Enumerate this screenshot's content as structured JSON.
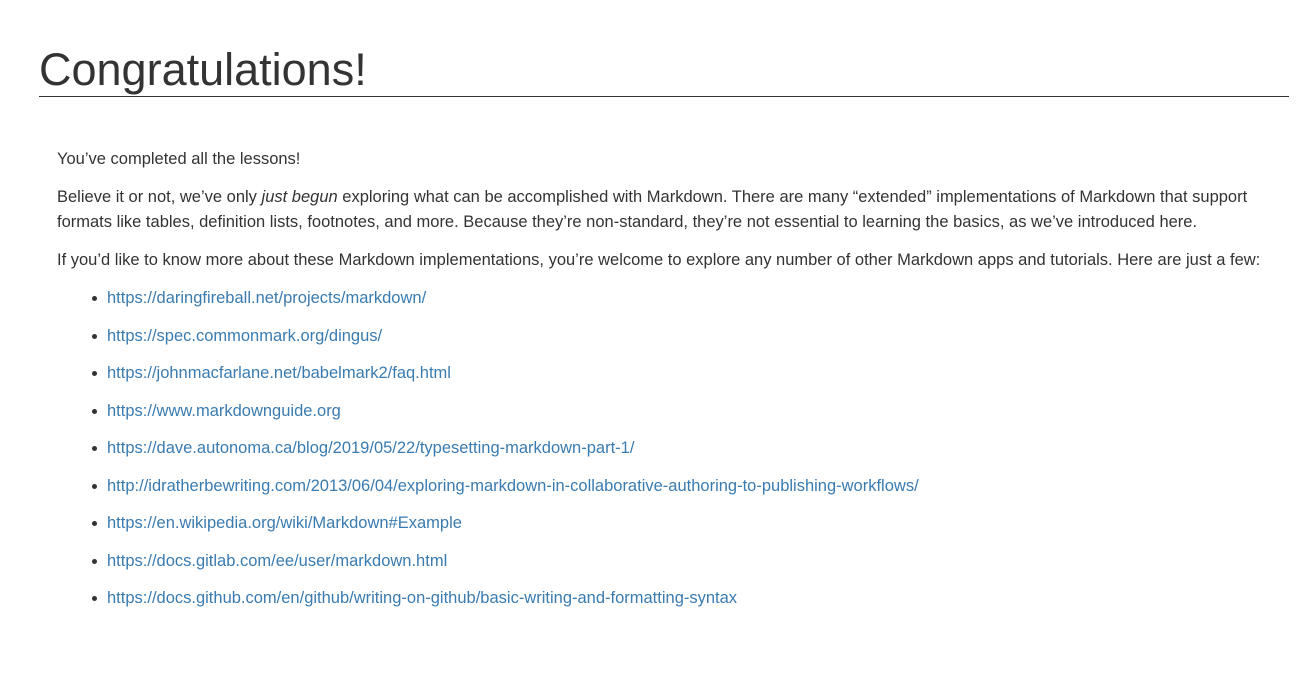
{
  "page": {
    "title": "Congratulations!",
    "intro": "You’ve completed all the lessons!",
    "para2": {
      "before": "Believe it or not, we’ve only ",
      "emphasis": "just begun",
      "after": " exploring what can be accomplished with Markdown. There are many “extended” implementations of Markdown that support formats like tables, definition lists, footnotes, and more. Because they’re non-standard, they’re not essential to learning the basics, as we’ve introduced here."
    },
    "para3": "If you’d like to know more about these Markdown implementations, you’re welcome to explore any number of other Markdown apps and tutorials. Here are just a few:"
  },
  "links": [
    "https://daringfireball.net/projects/markdown/",
    "https://spec.commonmark.org/dingus/",
    "https://johnmacfarlane.net/babelmark2/faq.html",
    "https://www.markdownguide.org",
    "https://dave.autonoma.ca/blog/2019/05/22/typesetting-markdown-part-1/",
    "http://idratherbewriting.com/2013/06/04/exploring-markdown-in-collaborative-authoring-to-publishing-workflows/",
    "https://en.wikipedia.org/wiki/Markdown#Example",
    "https://docs.gitlab.com/ee/user/markdown.html",
    "https://docs.github.com/en/github/writing-on-github/basic-writing-and-formatting-syntax"
  ],
  "colors": {
    "text": "#333333",
    "link": "#3a7bb0",
    "background": "#ffffff"
  }
}
